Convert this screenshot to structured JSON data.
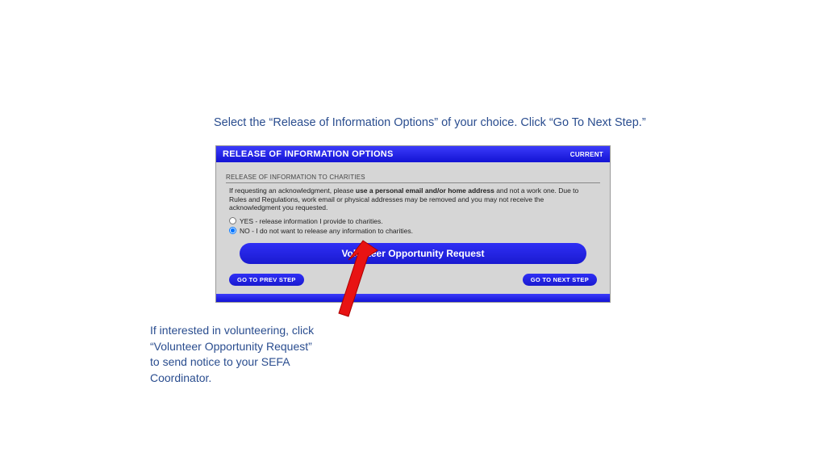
{
  "instruction_top": "Select the “Release of Information Options” of your choice.  Click “Go To Next Step.”",
  "panel": {
    "title": "RELEASE OF INFORMATION OPTIONS",
    "current_label": "CURRENT",
    "sub_header": "RELEASE OF INFORMATION TO CHARITIES",
    "disclaimer_pre": "If requesting an acknowledgment, please ",
    "disclaimer_bold": "use a personal email and/or home address",
    "disclaimer_post": " and not a work one. Due to Rules and Regulations, work email or physical addresses may be removed and you may not receive the acknowledgment you requested.",
    "option_yes": "YES - release information I provide to charities.",
    "option_no": "NO - I do not want to release any information to charities.",
    "volunteer_button": "Volunteer Opportunity Request",
    "prev_button": "GO TO PREV STEP",
    "next_button": "GO TO NEXT STEP"
  },
  "instruction_bottom": "If interested in volunteering, click “Volunteer Opportunity Request” to send notice to your SEFA Coordinator."
}
